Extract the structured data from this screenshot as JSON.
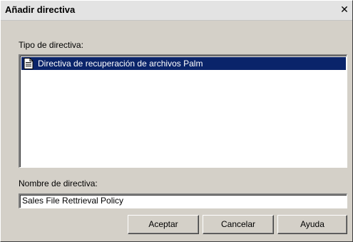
{
  "window": {
    "title": "Añadir directiva",
    "close_glyph": "✕"
  },
  "policy_type": {
    "label": "Tipo de directiva:",
    "items": [
      {
        "label": "Directiva de recuperación de archivos Palm",
        "icon": "document-icon",
        "selected": true
      }
    ]
  },
  "policy_name": {
    "label": "Nombre de directiva:",
    "value": "Sales File Rettrieval Policy"
  },
  "buttons": {
    "accept": "Aceptar",
    "cancel": "Cancelar",
    "help": "Ayuda"
  },
  "colors": {
    "dialog_bg": "#d4d0c8",
    "selection_bg": "#0a246a",
    "selection_text": "#ffffff"
  }
}
